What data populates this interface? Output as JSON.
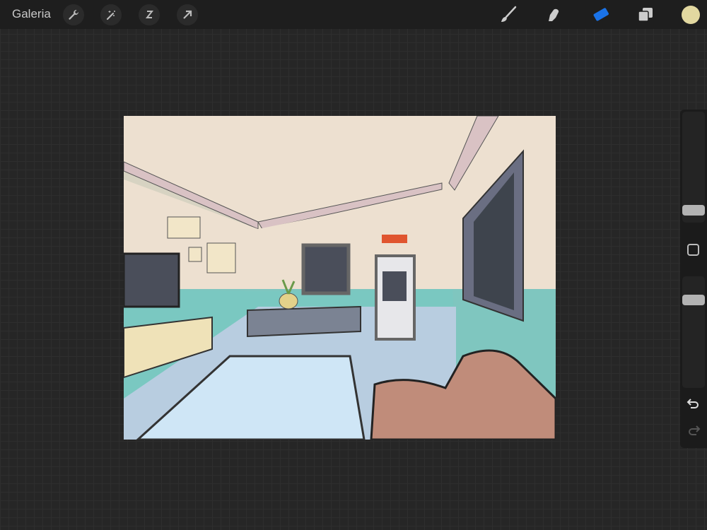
{
  "topbar": {
    "gallery_label": "Galeria",
    "tools_left": [
      "wrench-icon",
      "magic-wand-icon",
      "selection-icon",
      "transform-arrow-icon"
    ],
    "tools_right": [
      "brush-icon",
      "smudge-icon",
      "eraser-icon",
      "layers-icon",
      "color-swatch"
    ],
    "active_tool": "eraser",
    "accent": "#1a73e8",
    "current_color": "#e2d8a0"
  },
  "sidebar": {
    "brush_size": 0.15,
    "opacity": 0.8,
    "undo": "undo-icon",
    "redo": "redo-icon"
  }
}
